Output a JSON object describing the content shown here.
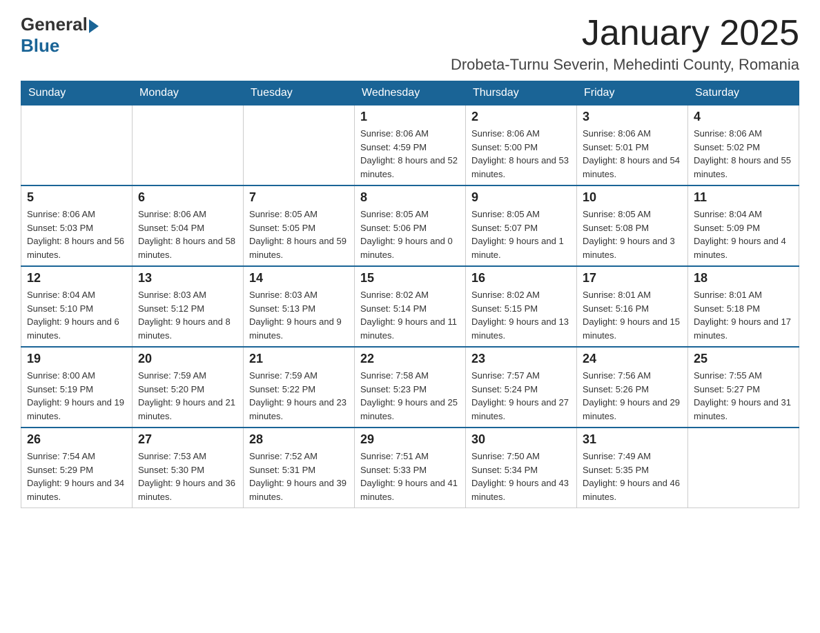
{
  "header": {
    "logo": {
      "general": "General",
      "blue": "Blue"
    },
    "title": "January 2025",
    "location": "Drobeta-Turnu Severin, Mehedinti County, Romania"
  },
  "calendar": {
    "days_of_week": [
      "Sunday",
      "Monday",
      "Tuesday",
      "Wednesday",
      "Thursday",
      "Friday",
      "Saturday"
    ],
    "weeks": [
      [
        {
          "day": "",
          "sunrise": "",
          "sunset": "",
          "daylight": ""
        },
        {
          "day": "",
          "sunrise": "",
          "sunset": "",
          "daylight": ""
        },
        {
          "day": "",
          "sunrise": "",
          "sunset": "",
          "daylight": ""
        },
        {
          "day": "1",
          "sunrise": "Sunrise: 8:06 AM",
          "sunset": "Sunset: 4:59 PM",
          "daylight": "Daylight: 8 hours and 52 minutes."
        },
        {
          "day": "2",
          "sunrise": "Sunrise: 8:06 AM",
          "sunset": "Sunset: 5:00 PM",
          "daylight": "Daylight: 8 hours and 53 minutes."
        },
        {
          "day": "3",
          "sunrise": "Sunrise: 8:06 AM",
          "sunset": "Sunset: 5:01 PM",
          "daylight": "Daylight: 8 hours and 54 minutes."
        },
        {
          "day": "4",
          "sunrise": "Sunrise: 8:06 AM",
          "sunset": "Sunset: 5:02 PM",
          "daylight": "Daylight: 8 hours and 55 minutes."
        }
      ],
      [
        {
          "day": "5",
          "sunrise": "Sunrise: 8:06 AM",
          "sunset": "Sunset: 5:03 PM",
          "daylight": "Daylight: 8 hours and 56 minutes."
        },
        {
          "day": "6",
          "sunrise": "Sunrise: 8:06 AM",
          "sunset": "Sunset: 5:04 PM",
          "daylight": "Daylight: 8 hours and 58 minutes."
        },
        {
          "day": "7",
          "sunrise": "Sunrise: 8:05 AM",
          "sunset": "Sunset: 5:05 PM",
          "daylight": "Daylight: 8 hours and 59 minutes."
        },
        {
          "day": "8",
          "sunrise": "Sunrise: 8:05 AM",
          "sunset": "Sunset: 5:06 PM",
          "daylight": "Daylight: 9 hours and 0 minutes."
        },
        {
          "day": "9",
          "sunrise": "Sunrise: 8:05 AM",
          "sunset": "Sunset: 5:07 PM",
          "daylight": "Daylight: 9 hours and 1 minute."
        },
        {
          "day": "10",
          "sunrise": "Sunrise: 8:05 AM",
          "sunset": "Sunset: 5:08 PM",
          "daylight": "Daylight: 9 hours and 3 minutes."
        },
        {
          "day": "11",
          "sunrise": "Sunrise: 8:04 AM",
          "sunset": "Sunset: 5:09 PM",
          "daylight": "Daylight: 9 hours and 4 minutes."
        }
      ],
      [
        {
          "day": "12",
          "sunrise": "Sunrise: 8:04 AM",
          "sunset": "Sunset: 5:10 PM",
          "daylight": "Daylight: 9 hours and 6 minutes."
        },
        {
          "day": "13",
          "sunrise": "Sunrise: 8:03 AM",
          "sunset": "Sunset: 5:12 PM",
          "daylight": "Daylight: 9 hours and 8 minutes."
        },
        {
          "day": "14",
          "sunrise": "Sunrise: 8:03 AM",
          "sunset": "Sunset: 5:13 PM",
          "daylight": "Daylight: 9 hours and 9 minutes."
        },
        {
          "day": "15",
          "sunrise": "Sunrise: 8:02 AM",
          "sunset": "Sunset: 5:14 PM",
          "daylight": "Daylight: 9 hours and 11 minutes."
        },
        {
          "day": "16",
          "sunrise": "Sunrise: 8:02 AM",
          "sunset": "Sunset: 5:15 PM",
          "daylight": "Daylight: 9 hours and 13 minutes."
        },
        {
          "day": "17",
          "sunrise": "Sunrise: 8:01 AM",
          "sunset": "Sunset: 5:16 PM",
          "daylight": "Daylight: 9 hours and 15 minutes."
        },
        {
          "day": "18",
          "sunrise": "Sunrise: 8:01 AM",
          "sunset": "Sunset: 5:18 PM",
          "daylight": "Daylight: 9 hours and 17 minutes."
        }
      ],
      [
        {
          "day": "19",
          "sunrise": "Sunrise: 8:00 AM",
          "sunset": "Sunset: 5:19 PM",
          "daylight": "Daylight: 9 hours and 19 minutes."
        },
        {
          "day": "20",
          "sunrise": "Sunrise: 7:59 AM",
          "sunset": "Sunset: 5:20 PM",
          "daylight": "Daylight: 9 hours and 21 minutes."
        },
        {
          "day": "21",
          "sunrise": "Sunrise: 7:59 AM",
          "sunset": "Sunset: 5:22 PM",
          "daylight": "Daylight: 9 hours and 23 minutes."
        },
        {
          "day": "22",
          "sunrise": "Sunrise: 7:58 AM",
          "sunset": "Sunset: 5:23 PM",
          "daylight": "Daylight: 9 hours and 25 minutes."
        },
        {
          "day": "23",
          "sunrise": "Sunrise: 7:57 AM",
          "sunset": "Sunset: 5:24 PM",
          "daylight": "Daylight: 9 hours and 27 minutes."
        },
        {
          "day": "24",
          "sunrise": "Sunrise: 7:56 AM",
          "sunset": "Sunset: 5:26 PM",
          "daylight": "Daylight: 9 hours and 29 minutes."
        },
        {
          "day": "25",
          "sunrise": "Sunrise: 7:55 AM",
          "sunset": "Sunset: 5:27 PM",
          "daylight": "Daylight: 9 hours and 31 minutes."
        }
      ],
      [
        {
          "day": "26",
          "sunrise": "Sunrise: 7:54 AM",
          "sunset": "Sunset: 5:29 PM",
          "daylight": "Daylight: 9 hours and 34 minutes."
        },
        {
          "day": "27",
          "sunrise": "Sunrise: 7:53 AM",
          "sunset": "Sunset: 5:30 PM",
          "daylight": "Daylight: 9 hours and 36 minutes."
        },
        {
          "day": "28",
          "sunrise": "Sunrise: 7:52 AM",
          "sunset": "Sunset: 5:31 PM",
          "daylight": "Daylight: 9 hours and 39 minutes."
        },
        {
          "day": "29",
          "sunrise": "Sunrise: 7:51 AM",
          "sunset": "Sunset: 5:33 PM",
          "daylight": "Daylight: 9 hours and 41 minutes."
        },
        {
          "day": "30",
          "sunrise": "Sunrise: 7:50 AM",
          "sunset": "Sunset: 5:34 PM",
          "daylight": "Daylight: 9 hours and 43 minutes."
        },
        {
          "day": "31",
          "sunrise": "Sunrise: 7:49 AM",
          "sunset": "Sunset: 5:35 PM",
          "daylight": "Daylight: 9 hours and 46 minutes."
        },
        {
          "day": "",
          "sunrise": "",
          "sunset": "",
          "daylight": ""
        }
      ]
    ]
  }
}
